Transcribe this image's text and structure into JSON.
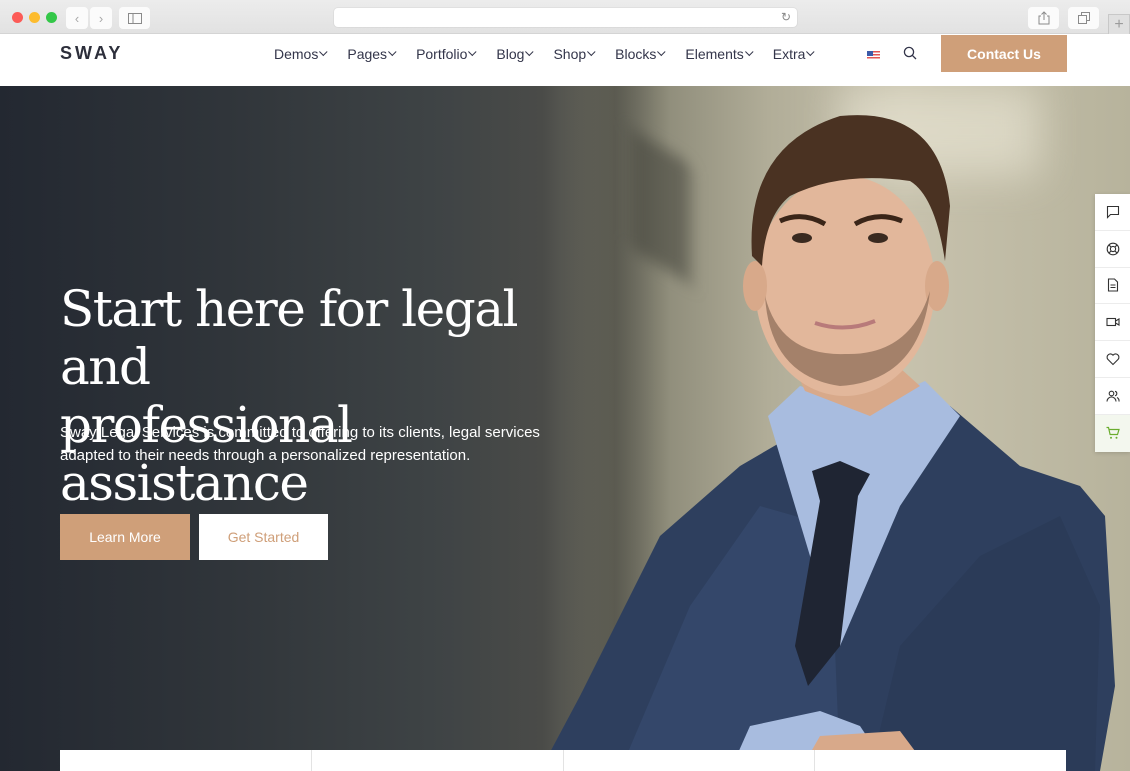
{
  "browser": {
    "address": "",
    "icons": [
      "close-window",
      "minimize-window",
      "zoom-window",
      "back-arrow",
      "forward-arrow",
      "sidebar-toggle",
      "reload",
      "share",
      "tabs-overview",
      "new-tab-plus"
    ]
  },
  "header": {
    "logo": "SWAY",
    "nav": [
      {
        "label": "Demos"
      },
      {
        "label": "Pages"
      },
      {
        "label": "Portfolio"
      },
      {
        "label": "Blog"
      },
      {
        "label": "Shop"
      },
      {
        "label": "Blocks"
      },
      {
        "label": "Elements"
      },
      {
        "label": "Extra"
      }
    ],
    "language_flag": "us-flag",
    "contact_label": "Contact Us"
  },
  "hero": {
    "title_line1": "Start here for legal and",
    "title_line2": "professional assistance",
    "description": "Sway Legal Services is committed to offering to its clients, legal services adapted to their needs through a personalized representation.",
    "primary_button": "Learn More",
    "secondary_button": "Get Started"
  },
  "side_toolbar": {
    "items": [
      "chat",
      "support",
      "document",
      "video",
      "favorite",
      "users",
      "cart"
    ]
  },
  "colors": {
    "accent": "#cf9f79",
    "nav_text": "#33354a",
    "cart_green": "#6aac2e"
  }
}
